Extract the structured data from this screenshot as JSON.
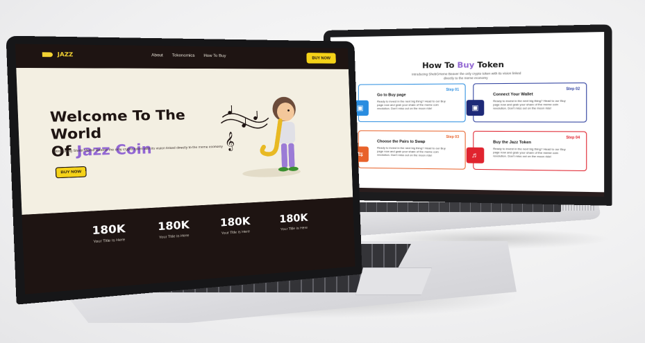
{
  "right_site": {
    "title_prefix": "How To",
    "title_accent": "Buy",
    "title_suffix": "Token",
    "subtitle": "Introducing ShebGHeme Beaver the only crypto token with its vision linked directly to the meme economy",
    "steps": [
      {
        "num": "Step 01",
        "title": "Go to Buy page",
        "desc": "Ready to invest in the next big thing? Head to our Buy page now and grab your share of the meme coin revolution. Don't miss out on the moon ride!",
        "color": "#2a8de0",
        "icon": "wallet-icon"
      },
      {
        "num": "Step 02",
        "title": "Connect Your Wallet",
        "desc": "Ready to invest in the next big thing? Head to our Buy page now and grab your share of the meme coin revolution. Don't miss out on the moon ride!",
        "color": "#2c3e9e",
        "icon": "wallet-icon"
      },
      {
        "num": "Step 03",
        "title": "Choose the Pairs to Swap",
        "desc": "Ready to invest in the next big thing? Head to our Buy page now and grab your share of the meme coin revolution. Don't miss out on the moon ride!",
        "color": "#e8622a",
        "icon": "swap-icon"
      },
      {
        "num": "Step 04",
        "title": "Buy the Jazz Token",
        "desc": "Ready to invest in the next big thing? Head to our Buy page now and grab your share of the meme coin revolution. Don't miss out on the moon ride!",
        "color": "#e0242f",
        "icon": "trumpet-icon"
      }
    ]
  },
  "left_site": {
    "logo_text": "JAZZ",
    "nav": [
      "About",
      "Tokenomics",
      "How To Buy"
    ],
    "nav_button": "BUY NOW",
    "hero_line1": "Welcome To The World",
    "hero_line2_prefix": "Of",
    "hero_line2_accent": "Jazz Coin",
    "hero_sub": "Introducing Shebl Meme Beaver the only crypto token with its vision linked directly to the meme economy",
    "hero_button": "BUY NOW",
    "stats": [
      {
        "value": "180K",
        "label": "Your Title Is Here"
      },
      {
        "value": "180K",
        "label": "Your Title Is Here"
      },
      {
        "value": "180K",
        "label": "Your Title Is Here"
      },
      {
        "value": "180K",
        "label": "Your Title Is Here"
      }
    ]
  },
  "colors": {
    "accent_purple": "#9266d3",
    "button_yellow": "#f5d218",
    "dark_bg": "#1e1412",
    "cream_bg": "#f3efe2"
  }
}
